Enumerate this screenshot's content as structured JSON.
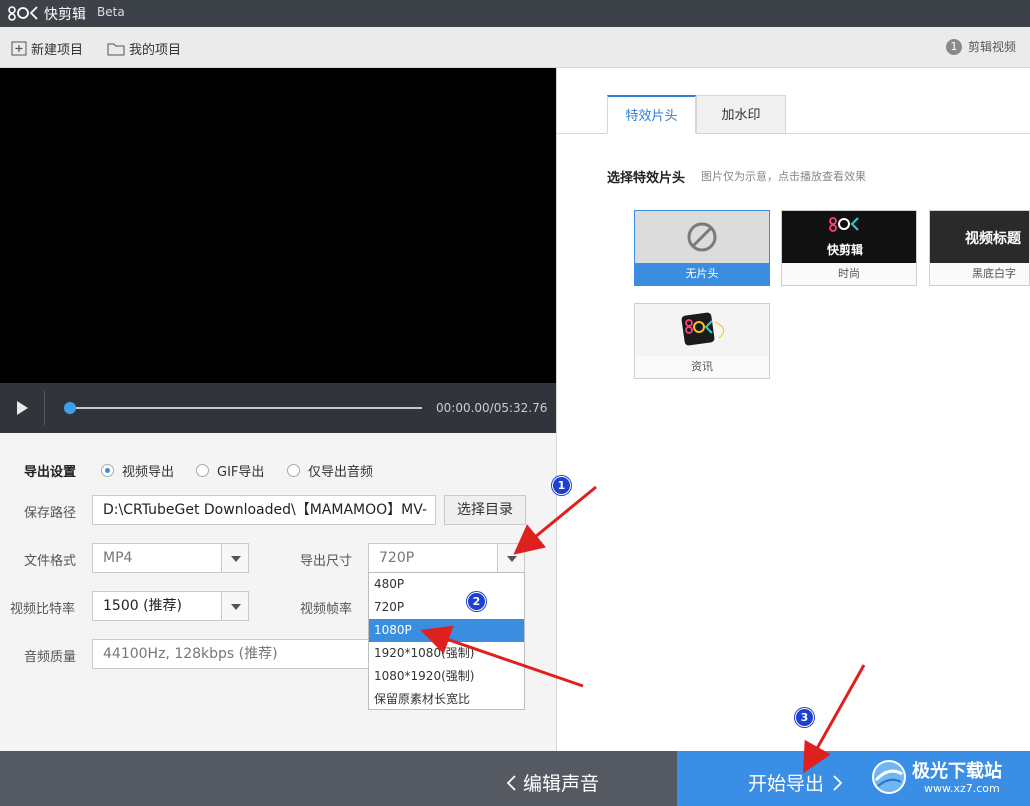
{
  "titlebar": {
    "title": "快剪辑",
    "beta": "Beta",
    "logo_icon": "kuaijianji-logo-icon"
  },
  "toolbar": {
    "new_project": "新建项目",
    "my_projects": "我的项目",
    "step_number": "1",
    "step_label": "剪辑视频"
  },
  "player": {
    "time": "00:00.00/05:32.76",
    "progress": 0.0
  },
  "export": {
    "section_label": "导出设置",
    "modes": [
      {
        "label": "视频导出",
        "selected": true
      },
      {
        "label": "GIF导出",
        "selected": false
      },
      {
        "label": "仅导出音频",
        "selected": false
      }
    ],
    "path_label": "保存路径",
    "path_value": "D:\\CRTubeGet Downloaded\\【MAMAMOO】MV-",
    "choose_dir": "选择目录",
    "format_label": "文件格式",
    "format_value": "MP4",
    "size_label": "导出尺寸",
    "size_value": "720P",
    "bitrate_label": "视频比特率",
    "bitrate_value": "1500 (推荐)",
    "framerate_label": "视频帧率",
    "audio_label": "音频质量",
    "audio_value": "44100Hz, 128kbps (推荐)",
    "size_options": [
      "480P",
      "720P",
      "1080P",
      "1920*1080(强制)",
      "1080*1920(强制)",
      "保留原素材长宽比"
    ],
    "size_selected_index": 2
  },
  "right_panel": {
    "tabs": [
      "特效片头",
      "加水印"
    ],
    "active_tab": 0,
    "section_title": "选择特效片头",
    "section_hint": "图片仅为示意，点击播放查看效果",
    "intros": [
      {
        "caption": "无片头",
        "selected": true
      },
      {
        "caption": "时尚",
        "thumb_text": "快剪辑"
      },
      {
        "caption": "黑底白字",
        "thumb_text": "视频标题"
      },
      {
        "caption": "资讯"
      }
    ]
  },
  "bottom": {
    "edit_audio": "编辑声音",
    "start_export": "开始导出"
  },
  "annotations": [
    "1",
    "2",
    "3"
  ],
  "watermark": {
    "text": "极光下载站",
    "url": "www.xz7.com"
  },
  "colors": {
    "accent": "#3b8de0",
    "titlebar": "#3d4148",
    "bottom_left": "#555a62",
    "bottom_right": "#3a8ee6",
    "arrow": "#e0201f",
    "marker": "#1e3fd0"
  }
}
